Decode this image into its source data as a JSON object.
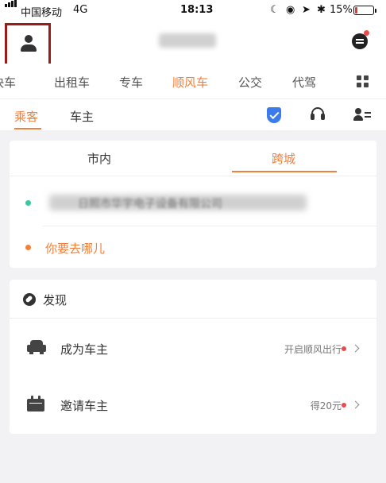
{
  "status_bar": {
    "carrier": "中国移动",
    "network": "4G",
    "time": "18:13",
    "battery_text": "15%",
    "battery_level": 0.15
  },
  "header": {
    "avatar": "user-icon",
    "message_icon": "message-icon"
  },
  "service_tabs": {
    "items": [
      "快车",
      "出租车",
      "专车",
      "顺风车",
      "公交",
      "代驾"
    ],
    "active": "顺风车"
  },
  "role_tabs": {
    "passenger": "乘客",
    "driver": "车主",
    "active": "乘客"
  },
  "trip": {
    "tab_city": "市内",
    "tab_intercity": "跨城",
    "active_tab": "跨城",
    "origin": "日照市华宇电子设备有限公司",
    "destination_placeholder": "你要去哪儿"
  },
  "discover": {
    "title": "发现",
    "items": [
      {
        "label": "成为车主",
        "hint": "开启顺风出行",
        "icon": "car-icon"
      },
      {
        "label": "邀请车主",
        "hint": "得20元",
        "icon": "calendar-icon"
      }
    ]
  },
  "colors": {
    "accent": "#f0813d",
    "badge_red": "#e84c4c",
    "shield_blue": "#3b7bea",
    "origin_green": "#3ec6a0",
    "highlight_box": "#9b1b1b"
  }
}
